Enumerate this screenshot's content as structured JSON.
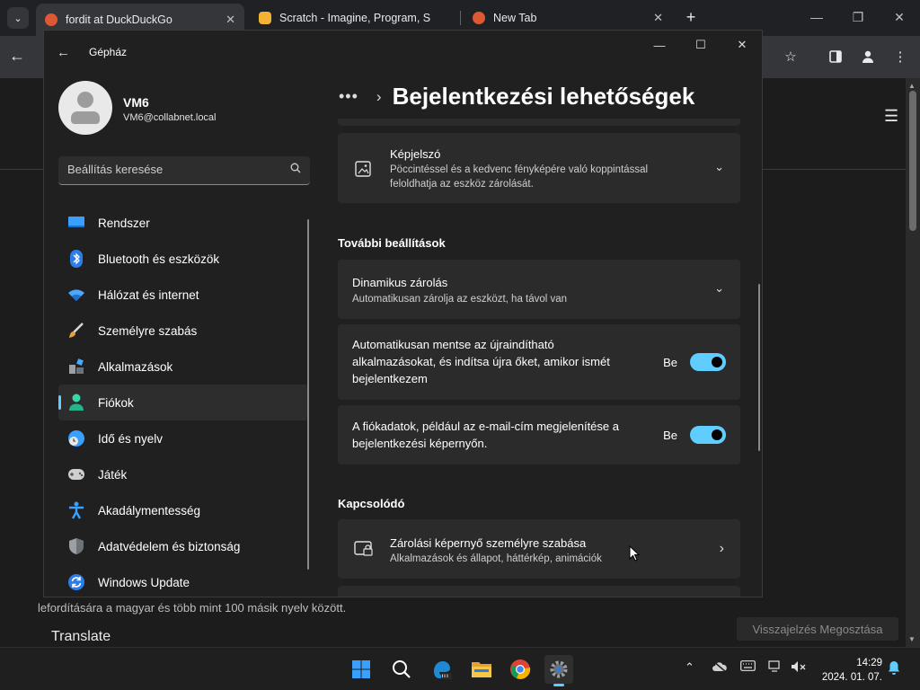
{
  "browser": {
    "tabs": [
      {
        "title": "fordit at DuckDuckGo",
        "active": true
      },
      {
        "title": "Scratch - Imagine, Program, Sh",
        "active": false
      },
      {
        "title": "New Tab",
        "active": false
      }
    ]
  },
  "page": {
    "body_text": "lefordítására a magyar és több mint 100 másik nyelv között.",
    "translate_heading": "Translate",
    "feedback_button": "Visszajelzés Megosztása"
  },
  "settings": {
    "app_title": "Gépház",
    "user": {
      "name": "VM6",
      "email": "VM6@collabnet.local"
    },
    "search_placeholder": "Beállítás keresése",
    "nav": [
      {
        "label": "Rendszer",
        "icon": "monitor-icon"
      },
      {
        "label": "Bluetooth és eszközök",
        "icon": "bluetooth-icon"
      },
      {
        "label": "Hálózat és internet",
        "icon": "wifi-icon"
      },
      {
        "label": "Személyre szabás",
        "icon": "brush-icon"
      },
      {
        "label": "Alkalmazások",
        "icon": "apps-icon"
      },
      {
        "label": "Fiókok",
        "icon": "account-icon",
        "selected": true
      },
      {
        "label": "Idő és nyelv",
        "icon": "globe-clock-icon"
      },
      {
        "label": "Játék",
        "icon": "gamepad-icon"
      },
      {
        "label": "Akadálymentesség",
        "icon": "accessibility-icon"
      },
      {
        "label": "Adatvédelem és biztonság",
        "icon": "shield-icon"
      },
      {
        "label": "Windows Update",
        "icon": "update-icon"
      }
    ],
    "breadcrumb": {
      "ellipsis": "•••",
      "title": "Bejelentkezési lehetőségek"
    },
    "picture_password": {
      "title": "Képjelszó",
      "line1": "Pöccintéssel és a kedvenc fényképére való koppintással",
      "line2": "feloldhatja az eszköz zárolását."
    },
    "additional_header": "További beállítások",
    "dynamic_lock": {
      "title": "Dinamikus zárolás",
      "subtitle": "Automatikusan zárolja az eszközt, ha távol van"
    },
    "restart_apps": {
      "line1": "Automatikusan mentse az újraindítható",
      "line2": "alkalmazásokat, és indítsa újra őket, amikor ismét",
      "line3": "bejelentkezem",
      "state": "Be"
    },
    "account_details": {
      "line1": "A fiókadatok, például az e-mail-cím megjelenítése a",
      "line2": "bejelentkezési képernyőn.",
      "state": "Be"
    },
    "related_header": "Kapcsolódó",
    "lock_screen": {
      "title": "Zárolási képernyő személyre szabása",
      "subtitle": "Alkalmazások és állapot, háttérkép, animációk"
    }
  },
  "taskbar": {
    "time": "14:29",
    "date": "2024. 01. 07.",
    "accent": "#60cdff"
  }
}
